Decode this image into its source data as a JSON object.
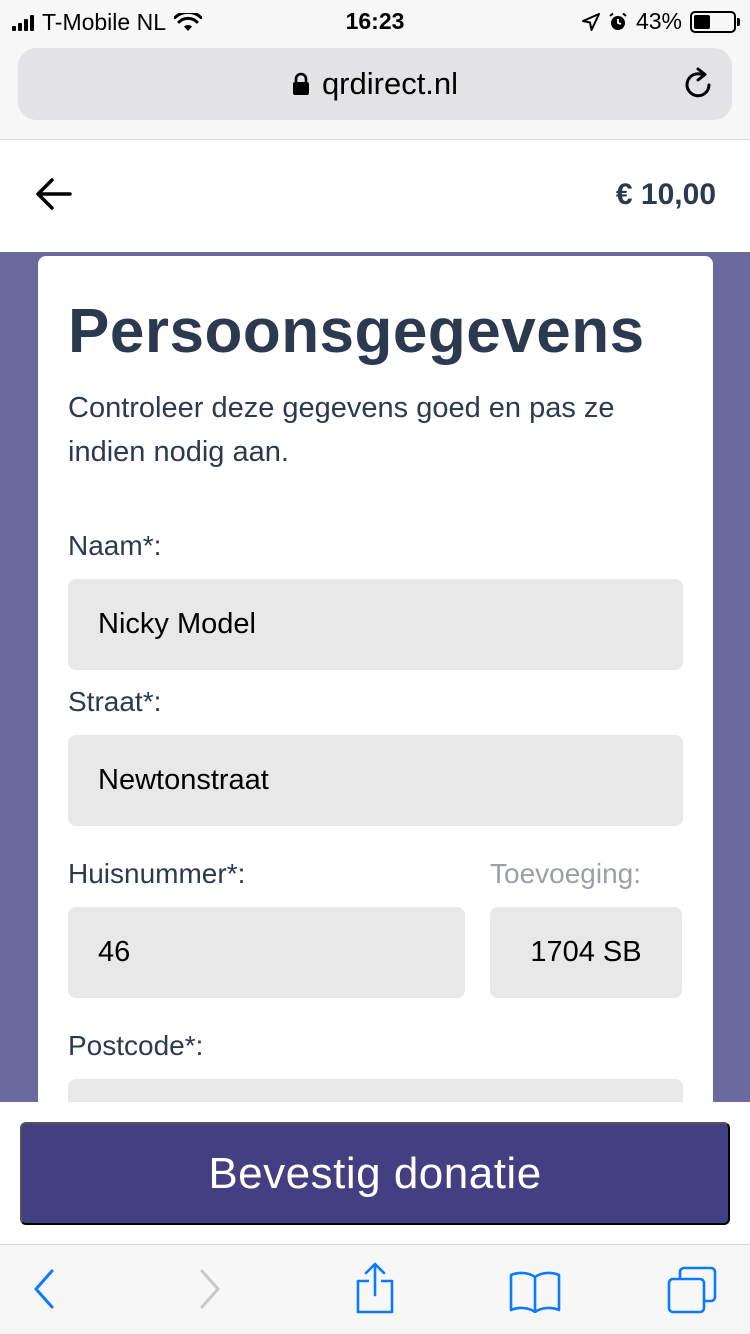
{
  "status_bar": {
    "carrier": "T-Mobile NL",
    "time": "16:23",
    "battery": "43%",
    "battery_level": 0.43
  },
  "browser": {
    "url": "qrdirect.nl"
  },
  "header": {
    "amount": "€ 10,00"
  },
  "form": {
    "title": "Persoonsgegevens",
    "subtitle": "Controleer deze gegevens goed en pas ze indien nodig aan.",
    "fields": {
      "naam": {
        "label": "Naam*:",
        "value": "Nicky Model"
      },
      "straat": {
        "label": "Straat*:",
        "value": "Newtonstraat"
      },
      "huisnummer": {
        "label": "Huisnummer*:",
        "value": "46"
      },
      "toevoeging": {
        "label": "Toevoeging:",
        "value": "1704 SB"
      },
      "postcode": {
        "label": "Postcode*:",
        "value": ""
      }
    }
  },
  "actions": {
    "confirm_label": "Bevestig donatie"
  },
  "colors": {
    "accent": "#433f82",
    "background_purple": "#6b6a9f",
    "ios_blue": "#0a7aff"
  }
}
